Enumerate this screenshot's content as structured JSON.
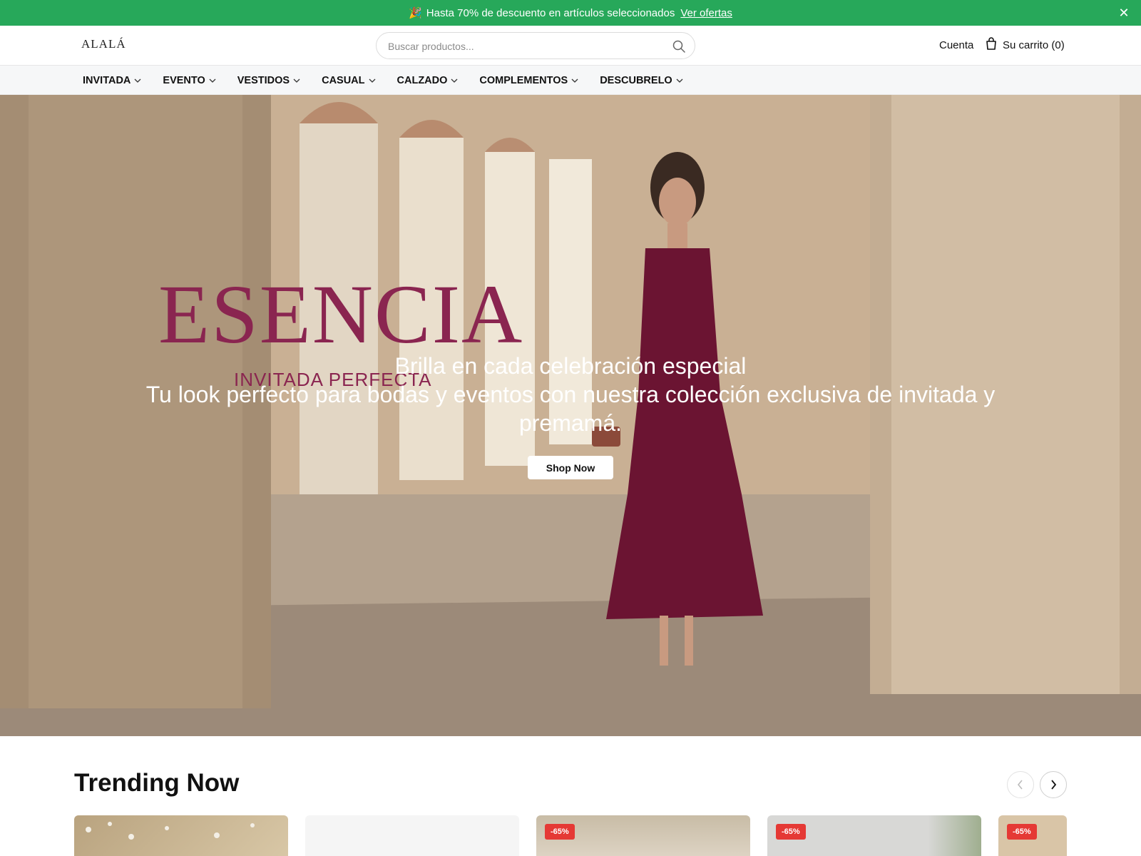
{
  "announcement": {
    "icon": "party-popper-icon",
    "emoji": "🎉",
    "text": "Hasta 70% de descuento en artículos seleccionados",
    "link": "Ver ofertas",
    "close": "✕"
  },
  "header": {
    "logo": "ALALÁ",
    "search_placeholder": "Buscar productos...",
    "account": "Cuenta",
    "cart": "Su carrito (0)"
  },
  "nav": {
    "items": [
      {
        "label": "INVITADA"
      },
      {
        "label": "EVENTO"
      },
      {
        "label": "VESTIDOS"
      },
      {
        "label": "CASUAL"
      },
      {
        "label": "CALZADO"
      },
      {
        "label": "COMPLEMENTOS"
      },
      {
        "label": "DESCUBRELO"
      }
    ]
  },
  "hero": {
    "brand": "ESENCIA",
    "brand_sub": "INVITADA PERFECTA",
    "title": "Brilla en cada celebración especial",
    "subtitle": "Tu look perfecto para bodas y eventos con nuestra colección exclusiva de invitada y premamá.",
    "cta": "Shop Now",
    "brand_color": "#8a2550"
  },
  "trending": {
    "title": "Trending Now",
    "cards": [
      {
        "badge": ""
      },
      {
        "badge": ""
      },
      {
        "badge": "-65%"
      },
      {
        "badge": "-65%"
      },
      {
        "badge": "-65%"
      }
    ]
  },
  "colors": {
    "announcement_bg": "#27a85a",
    "badge": "#e53935"
  }
}
